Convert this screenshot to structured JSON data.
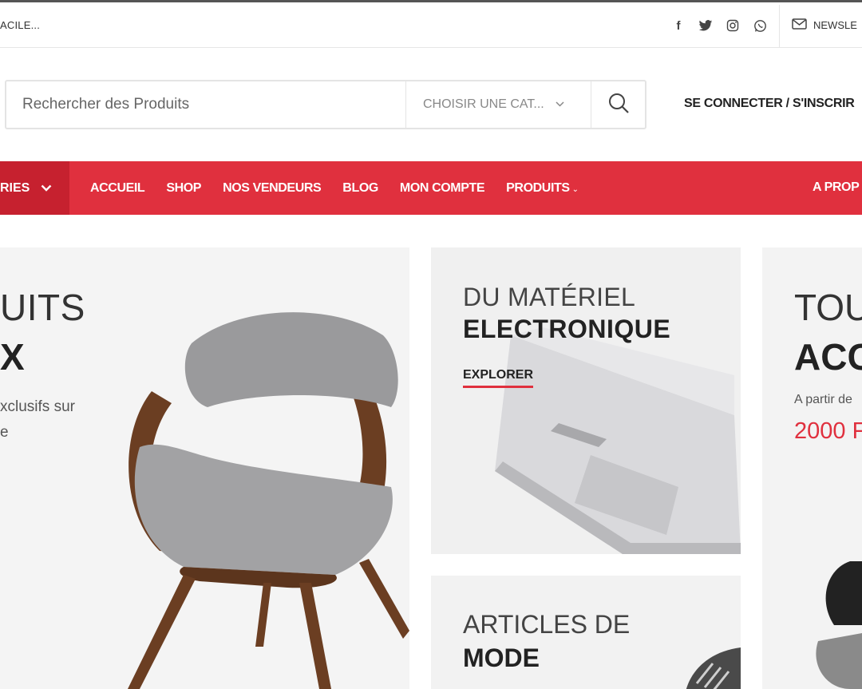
{
  "topbar": {
    "promo": "ACILE...",
    "social": [
      "facebook-icon",
      "twitter-icon",
      "instagram-icon",
      "whatsapp-icon"
    ],
    "newsletter": "NEWSLE"
  },
  "header": {
    "search_placeholder": "Rechercher des Produits",
    "category_select": "CHOISIR UNE CAT...",
    "login": "SE CONNECTER / S'INSCRIR"
  },
  "nav": {
    "categories_label": "RIES",
    "items": [
      {
        "label": "ACCUEIL"
      },
      {
        "label": "SHOP"
      },
      {
        "label": "NOS VENDEURS"
      },
      {
        "label": "BLOG"
      },
      {
        "label": "MON COMPTE"
      },
      {
        "label": "PRODUITS"
      }
    ],
    "about": "A PROP"
  },
  "banners": {
    "main": {
      "line1": "UITS",
      "line2": "X",
      "desc1": "xclusifs sur",
      "desc2": "e"
    },
    "electronics": {
      "line1": "DU MATÉRIEL",
      "line2": "ELECTRONIQUE",
      "cta": "EXPLORER"
    },
    "fashion": {
      "line1": "ARTICLES DE",
      "line2": "MODE"
    },
    "accessories": {
      "line1": "TOU",
      "line2": "ACC",
      "from": "A partir de",
      "price": "2000 F"
    }
  },
  "colors": {
    "accent": "#e0303e",
    "accent_dark": "#c6212f"
  }
}
